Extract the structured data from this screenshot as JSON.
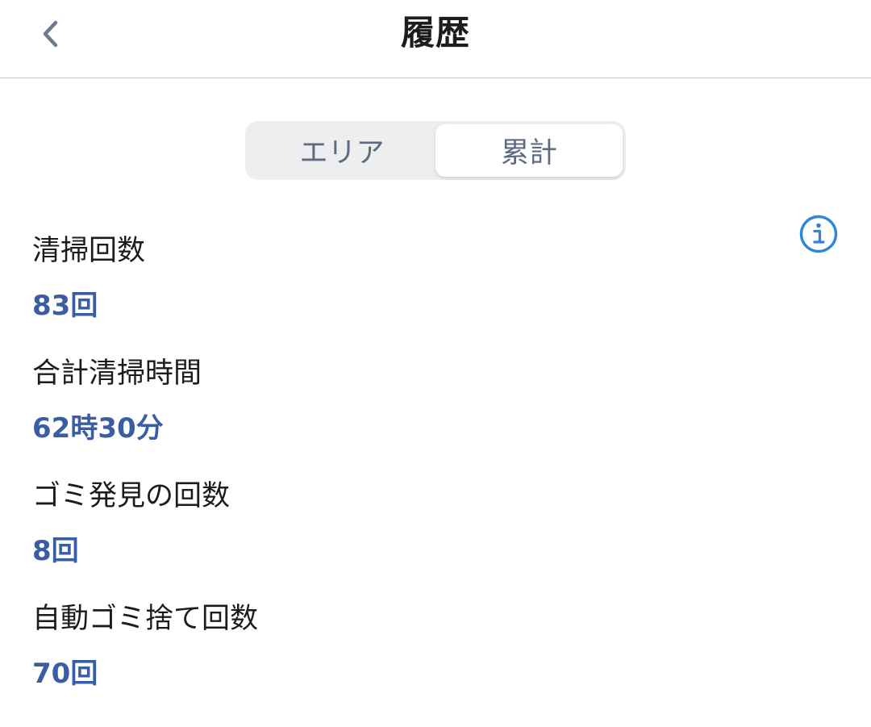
{
  "header": {
    "title": "履歴",
    "back_icon": "chevron-left-icon"
  },
  "tabs": [
    {
      "label": "エリア",
      "active": false
    },
    {
      "label": "累計",
      "active": true
    }
  ],
  "info_icon": "info-circle-icon",
  "stats": [
    {
      "label": "清掃回数",
      "value": "83回"
    },
    {
      "label": "合計清掃時間",
      "value": "62時30分"
    },
    {
      "label": "ゴミ発見の回数",
      "value": "8回"
    },
    {
      "label": "自動ゴミ捨て回数",
      "value": "70回"
    }
  ],
  "colors": {
    "accent_value": "#3a5ea3",
    "info_icon": "#2f86d6",
    "tab_text": "#5d6b80",
    "back_icon": "#6c7a90"
  }
}
